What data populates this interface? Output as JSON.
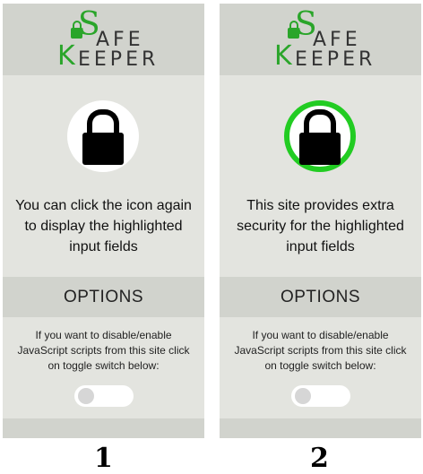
{
  "brand": {
    "initial_s": "S",
    "word1": "AFE",
    "initial_k": "K",
    "word2": "EEPER"
  },
  "panels": [
    {
      "lock_state": "inactive",
      "description": [
        "You can click the icon again",
        "to display the highlighted",
        "input fields"
      ],
      "options_label": "OPTIONS",
      "hint": [
        "If you want to disable/enable",
        "JavaScript scripts from this site click",
        "on toggle switch below:"
      ],
      "toggle_on": false
    },
    {
      "lock_state": "active",
      "description": [
        "This site provides extra",
        "security for the highlighted",
        "input fields"
      ],
      "options_label": "OPTIONS",
      "hint": [
        "If you want to disable/enable",
        "JavaScript scripts from this site click",
        "on toggle switch below:"
      ],
      "toggle_on": false
    }
  ],
  "numbers": [
    "1",
    "2"
  ],
  "colors": {
    "accent_green": "#2aa52a",
    "active_ring": "#22cc22",
    "panel_bg": "#e3e4df",
    "bar_bg": "#d1d3cd"
  },
  "icons": {
    "lock": "padlock-icon",
    "brand_lock": "mini-padlock-icon"
  }
}
